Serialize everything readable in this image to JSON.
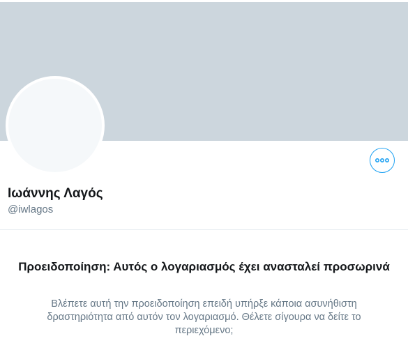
{
  "profile": {
    "display_name": "Ιωάννης Λαγός",
    "handle": "@iwlagos"
  },
  "actions": {
    "more_icon": "more-horizontal-icon"
  },
  "warning": {
    "title": "Προειδοποίηση: Αυτός ο λογαριασμός έχει ανασταλεί προσωρινά",
    "body": "Βλέπετε αυτή την προειδοποίηση επειδή υπήρξε κάποια ασυνήθιστη δραστηριότητα από αυτόν τον λογαριασμό. Θέλετε σίγουρα να δείτε το περιεχόμενο;"
  },
  "colors": {
    "banner": "#ccd6dd",
    "accent": "#1da1f2",
    "avatar_bg": "#f5f8fa",
    "text_primary": "#14171a",
    "text_secondary": "#657786"
  }
}
